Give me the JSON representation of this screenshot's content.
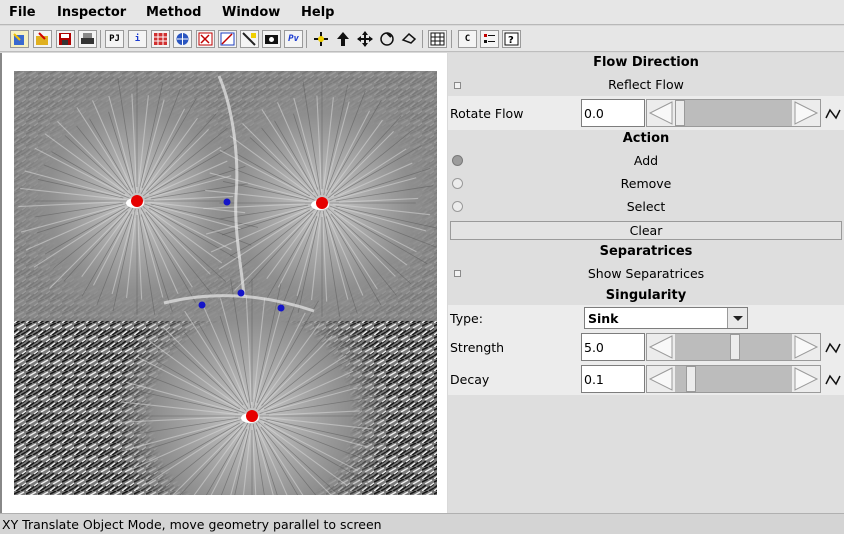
{
  "menu": [
    "File",
    "Inspector",
    "Method",
    "Window",
    "Help"
  ],
  "toolbar": {
    "icons": [
      "new-icon",
      "open-icon",
      "save-icon",
      "print-icon",
      "pj-icon",
      "info-icon",
      "image-icon",
      "sphere-icon",
      "flow-icon",
      "zoom-icon",
      "lasso-icon",
      "camera-icon",
      "python-icon",
      "translate-icon",
      "rotate-icon",
      "move-icon",
      "spin-icon",
      "hand-icon",
      "grid-icon",
      "c-icon",
      "list-icon",
      "help-icon"
    ],
    "pj_label": "PJ",
    "c_label": "C"
  },
  "panel": {
    "flow_direction": {
      "title": "Flow Direction",
      "reflect_label": "Reflect Flow",
      "rotate_label": "Rotate Flow",
      "rotate_value": "0.0",
      "rotate_slider_fraction": 0.0
    },
    "action": {
      "title": "Action",
      "options": [
        "Add",
        "Remove",
        "Select"
      ],
      "selected": "Add",
      "clear_label": "Clear"
    },
    "separatrices": {
      "title": "Separatrices",
      "show_label": "Show Separatrices"
    },
    "singularity": {
      "title": "Singularity",
      "type_label": "Type:",
      "type_value": "Sink",
      "strength_label": "Strength",
      "strength_value": "5.0",
      "strength_slider_fraction": 0.5,
      "decay_label": "Decay",
      "decay_value": "0.1",
      "decay_slider_fraction": 0.1
    }
  },
  "status": "XY Translate Object Mode, move geometry parallel to screen",
  "colors": {
    "singularity_red": "#e60000",
    "singularity_blue": "#1414c8"
  }
}
